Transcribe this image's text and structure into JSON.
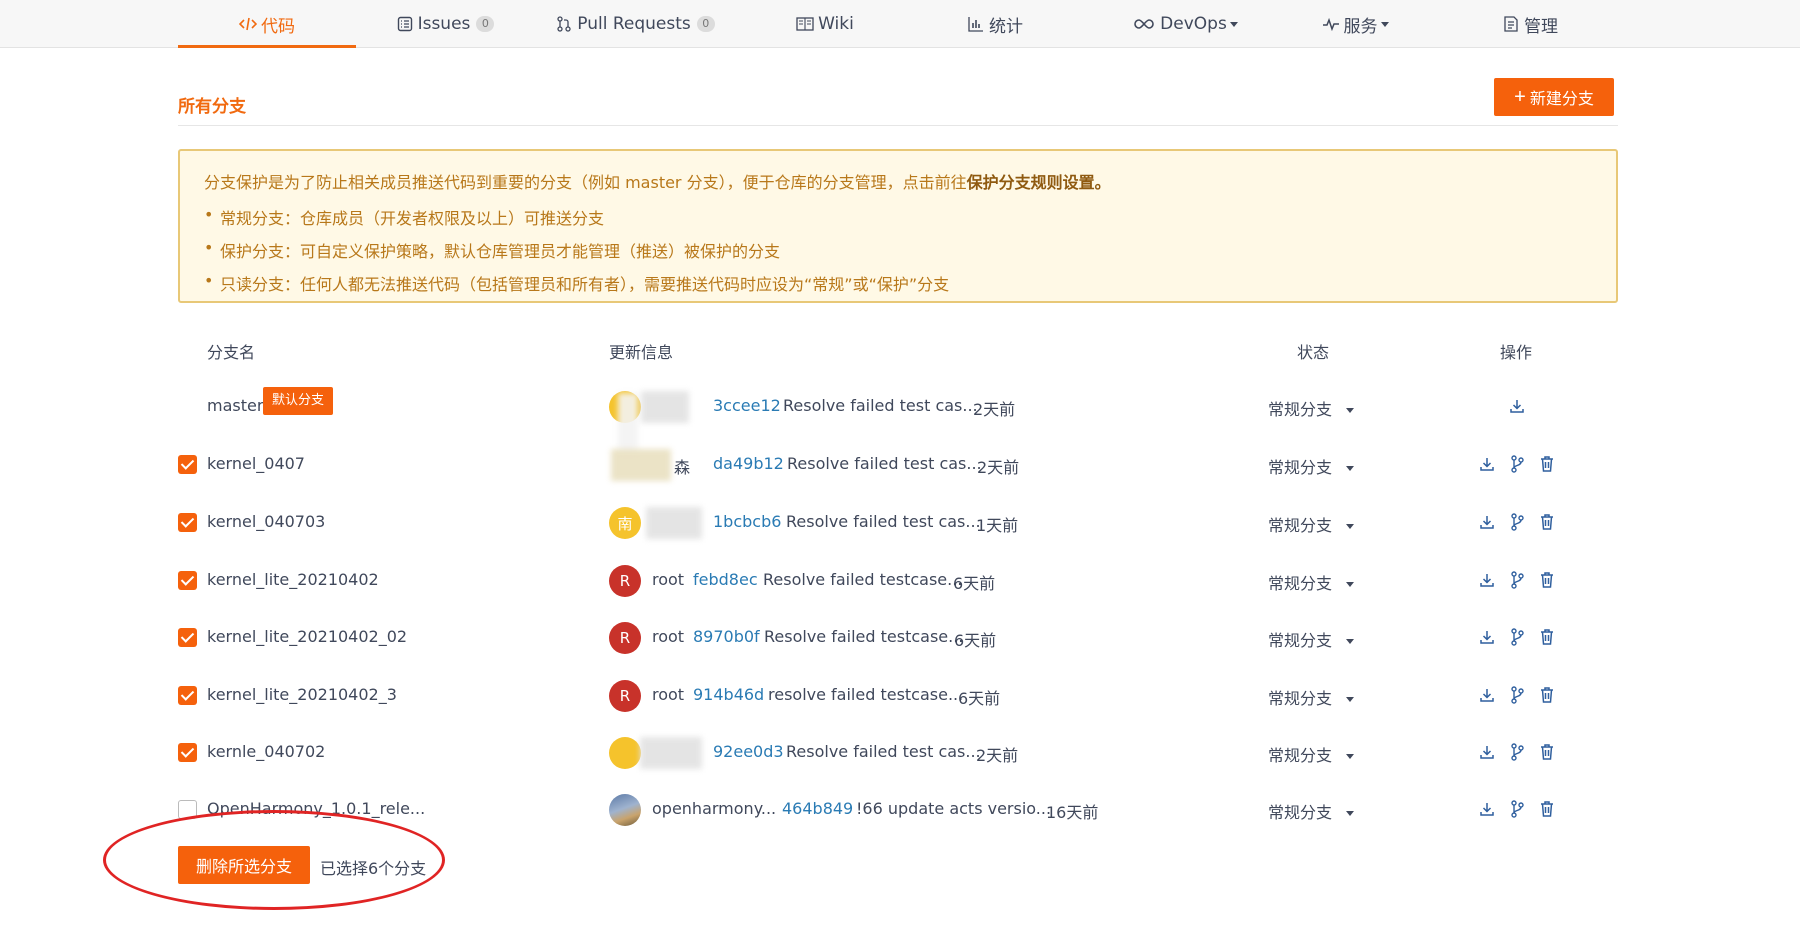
{
  "nav": {
    "tabs": [
      {
        "label": "代码",
        "icon": "code-icon",
        "active": true
      },
      {
        "label": "Issues",
        "icon": "issues-icon",
        "count": "0"
      },
      {
        "label": "Pull Requests",
        "icon": "pull-request-icon",
        "count": "0"
      },
      {
        "label": "Wiki",
        "icon": "book-icon"
      },
      {
        "label": "统计",
        "icon": "bar-chart-icon"
      },
      {
        "label": "DevOps",
        "icon": "infinity-icon"
      },
      {
        "label": "服务",
        "icon": "pulse-icon"
      },
      {
        "label": "管理",
        "icon": "document-icon"
      }
    ]
  },
  "section": {
    "title": "所有分支",
    "new_branch_label": "新建分支"
  },
  "notice": {
    "lead": "分支保护是为了防止相关成员推送代码到重要的分支（例如 master 分支），便于仓库的分支管理，点击前往",
    "lead_link": "保护分支规则设置。",
    "items": [
      "常规分支：仓库成员（开发者权限及以上）可推送分支",
      "保护分支：可自定义保护策略，默认仓库管理员才能管理（推送）被保护的分支",
      "只读分支：任何人都无法推送代码（包括管理员和所有者），需要推送代码时应设为“常规”或“保护”分支"
    ]
  },
  "table": {
    "headers": {
      "name": "分支名",
      "update": "更新信息",
      "status": "状态",
      "actions": "操作"
    },
    "default_tag": "默认分支",
    "rows": [
      {
        "name": "master",
        "checkbox": "none",
        "avatar": "",
        "author": "",
        "sha": "3ccee12",
        "message": "Resolve failed test cas...",
        "time": "2天前",
        "status": "常规分支"
      },
      {
        "name": "kernel_0407",
        "checkbox": "checked",
        "avatar": "",
        "author": "森",
        "sha": "da49b12",
        "message": "Resolve failed test cas...",
        "time": "2天前",
        "status": "常规分支"
      },
      {
        "name": "kernel_040703",
        "checkbox": "checked",
        "avatar": "南",
        "author": "",
        "sha": "1bcbcb6",
        "message": "Resolve failed test cas...",
        "time": "1天前",
        "status": "常规分支"
      },
      {
        "name": "kernel_lite_20210402",
        "checkbox": "checked",
        "avatar": "R",
        "author": "root",
        "sha": "febd8ec",
        "message": "Resolve failed testcase...",
        "time": "6天前",
        "status": "常规分支"
      },
      {
        "name": "kernel_lite_20210402_02",
        "checkbox": "checked",
        "avatar": "R",
        "author": "root",
        "sha": "8970b0f",
        "message": "Resolve failed testcase...",
        "time": "6天前",
        "status": "常规分支"
      },
      {
        "name": "kernel_lite_20210402_3",
        "checkbox": "checked",
        "avatar": "R",
        "author": "root",
        "sha": "914b46d",
        "message": "resolve failed testcase...",
        "time": "6天前",
        "status": "常规分支"
      },
      {
        "name": "kernle_040702",
        "checkbox": "checked",
        "avatar": "",
        "author": "",
        "sha": "92ee0d3",
        "message": "Resolve failed test cas...",
        "time": "2天前",
        "status": "常规分支"
      },
      {
        "name": "OpenHarmony_1.0.1_rele...",
        "checkbox": "unchecked",
        "avatar": "",
        "author": "openharmony...",
        "sha": "464b849",
        "message": "!66 update acts versio...",
        "time": "16天前",
        "status": "常规分支"
      }
    ]
  },
  "bulk": {
    "delete_label": "删除所选分支",
    "selected_text": "已选择6个分支"
  },
  "colors": {
    "accent": "#f5610c",
    "link": "#2a7bb4",
    "notice_bg": "#fff9e6",
    "annotation": "#e02424"
  }
}
